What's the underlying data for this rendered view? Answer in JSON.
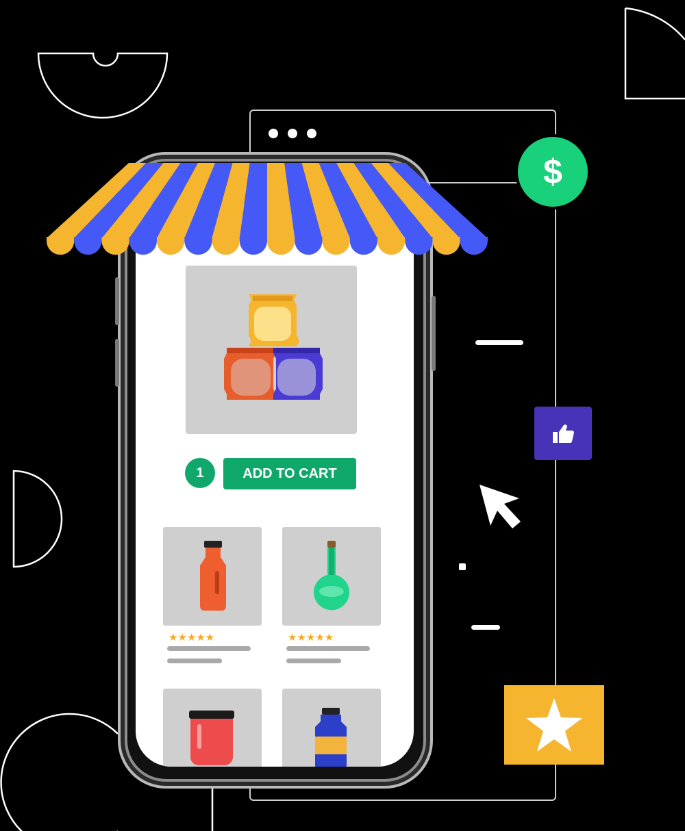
{
  "product": {
    "quantity": "1",
    "add_to_cart_label": "ADD TO CART"
  },
  "listings": [
    {
      "name": "orange-bottle-product",
      "stars": "★★★★★",
      "rating_stars": 5
    },
    {
      "name": "green-flask-product",
      "stars": "★★★★★",
      "rating_stars": 5
    },
    {
      "name": "red-jar-product"
    },
    {
      "name": "blue-bottle-product"
    }
  ],
  "badges": {
    "currency_symbol": "$"
  },
  "colors": {
    "background": "#000000",
    "accent_green": "#10a86a",
    "awning_orange": "#f6b52f",
    "awning_blue": "#4459f5",
    "dollar_green": "#1ad17b",
    "like_purple": "#4633b8",
    "favorite_yellow": "#f6b52f"
  },
  "icons": [
    "dollar-icon",
    "thumbs-up-icon",
    "star-icon",
    "cursor-arrow-icon",
    "snack-bags-icon"
  ]
}
